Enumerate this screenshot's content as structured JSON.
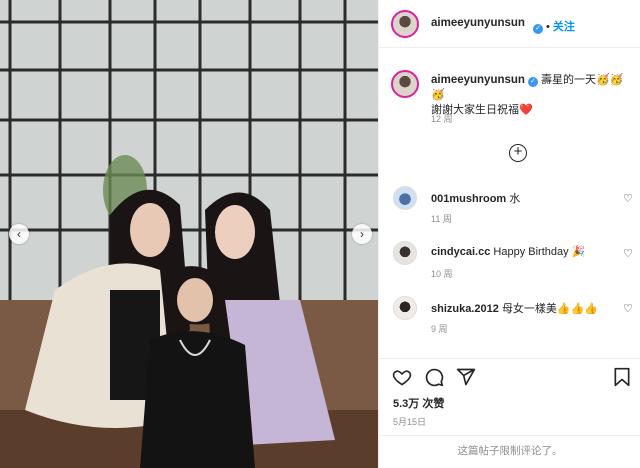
{
  "post": {
    "username": "aimeeyunyunsun",
    "verified_mark": "✓",
    "separator": "•",
    "follow_label": "关注",
    "caption_line1": "壽星的一天🥳🥳🥳",
    "caption_line2": "謝謝大家生日祝福❤️",
    "caption_time": "12 周"
  },
  "load_more_icon": "plus-circle-icon",
  "comments": [
    {
      "username": "001mushroom",
      "text": "水",
      "time": "11 周"
    },
    {
      "username": "cindycai.cc",
      "text": "Happy Birthday 🎉",
      "time": "10 周"
    },
    {
      "username": "shizuka.2012",
      "text": "母女一樣美👍👍👍",
      "time": "9 周"
    }
  ],
  "actions": {
    "likes": "5.3万 次赞",
    "date": "5月15日",
    "restricted_notice": "这篇帖子限制评论了。"
  },
  "colors": {
    "accent_blue": "#0095f6",
    "verified_blue": "#3897f0",
    "story_ring": "#d6249f",
    "muted_text": "#8e8e8e"
  }
}
